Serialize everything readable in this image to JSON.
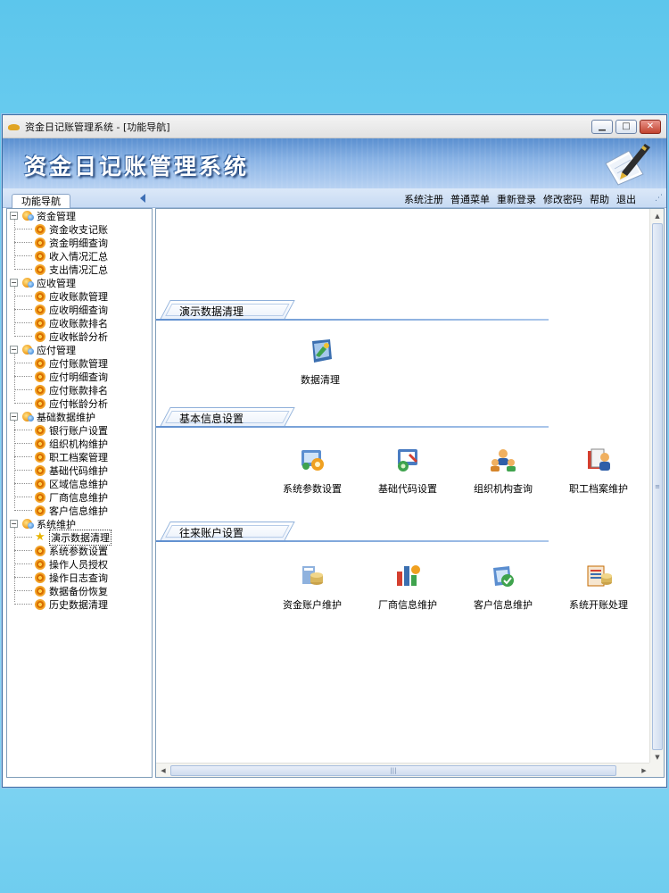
{
  "window": {
    "title": "资金日记账管理系统 - [功能导航]",
    "buttons": {
      "minimize": "▁",
      "maximize": "□",
      "close": "✕"
    }
  },
  "banner": {
    "title": "资金日记账管理系统"
  },
  "toolbar": {
    "nav_tab": "功能导航",
    "menu": [
      "系统注册",
      "普通菜单",
      "重新登录",
      "修改密码",
      "帮助",
      "退出"
    ]
  },
  "tree": [
    {
      "label": "资金管理",
      "children": [
        "资金收支记账",
        "资金明细查询",
        "收入情况汇总",
        "支出情况汇总"
      ]
    },
    {
      "label": "应收管理",
      "children": [
        "应收账款管理",
        "应收明细查询",
        "应收账款排名",
        "应收帐龄分析"
      ]
    },
    {
      "label": "应付管理",
      "children": [
        "应付账款管理",
        "应付明细查询",
        "应付账款排名",
        "应付帐龄分析"
      ]
    },
    {
      "label": "基础数据维护",
      "children": [
        "银行账户设置",
        "组织机构维护",
        "职工档案管理",
        "基础代码维护",
        "区域信息维护",
        "厂商信息维护",
        "客户信息维护"
      ]
    },
    {
      "label": "系统维护",
      "children": [
        "演示数据清理",
        "系统参数设置",
        "操作人员授权",
        "操作日志查询",
        "数据备份恢复",
        "历史数据清理"
      ],
      "selected_index": 0
    }
  ],
  "sections": [
    {
      "title": "演示数据清理",
      "items": [
        {
          "label": "数据清理",
          "icon": "data-clean-icon"
        }
      ]
    },
    {
      "title": "基本信息设置",
      "items": [
        {
          "label": "系统参数设置",
          "icon": "system-params-icon"
        },
        {
          "label": "基础代码设置",
          "icon": "base-code-icon"
        },
        {
          "label": "组织机构查询",
          "icon": "org-query-icon"
        },
        {
          "label": "职工档案维护",
          "icon": "staff-file-icon"
        }
      ]
    },
    {
      "title": "往来账户设置",
      "items": [
        {
          "label": "资金账户维护",
          "icon": "fund-account-icon"
        },
        {
          "label": "厂商信息维护",
          "icon": "vendor-info-icon"
        },
        {
          "label": "客户信息维护",
          "icon": "customer-info-icon"
        },
        {
          "label": "系统开账处理",
          "icon": "open-account-icon"
        }
      ]
    }
  ],
  "scrollbar": {
    "grip": "≡",
    "hgrip": "|||"
  }
}
